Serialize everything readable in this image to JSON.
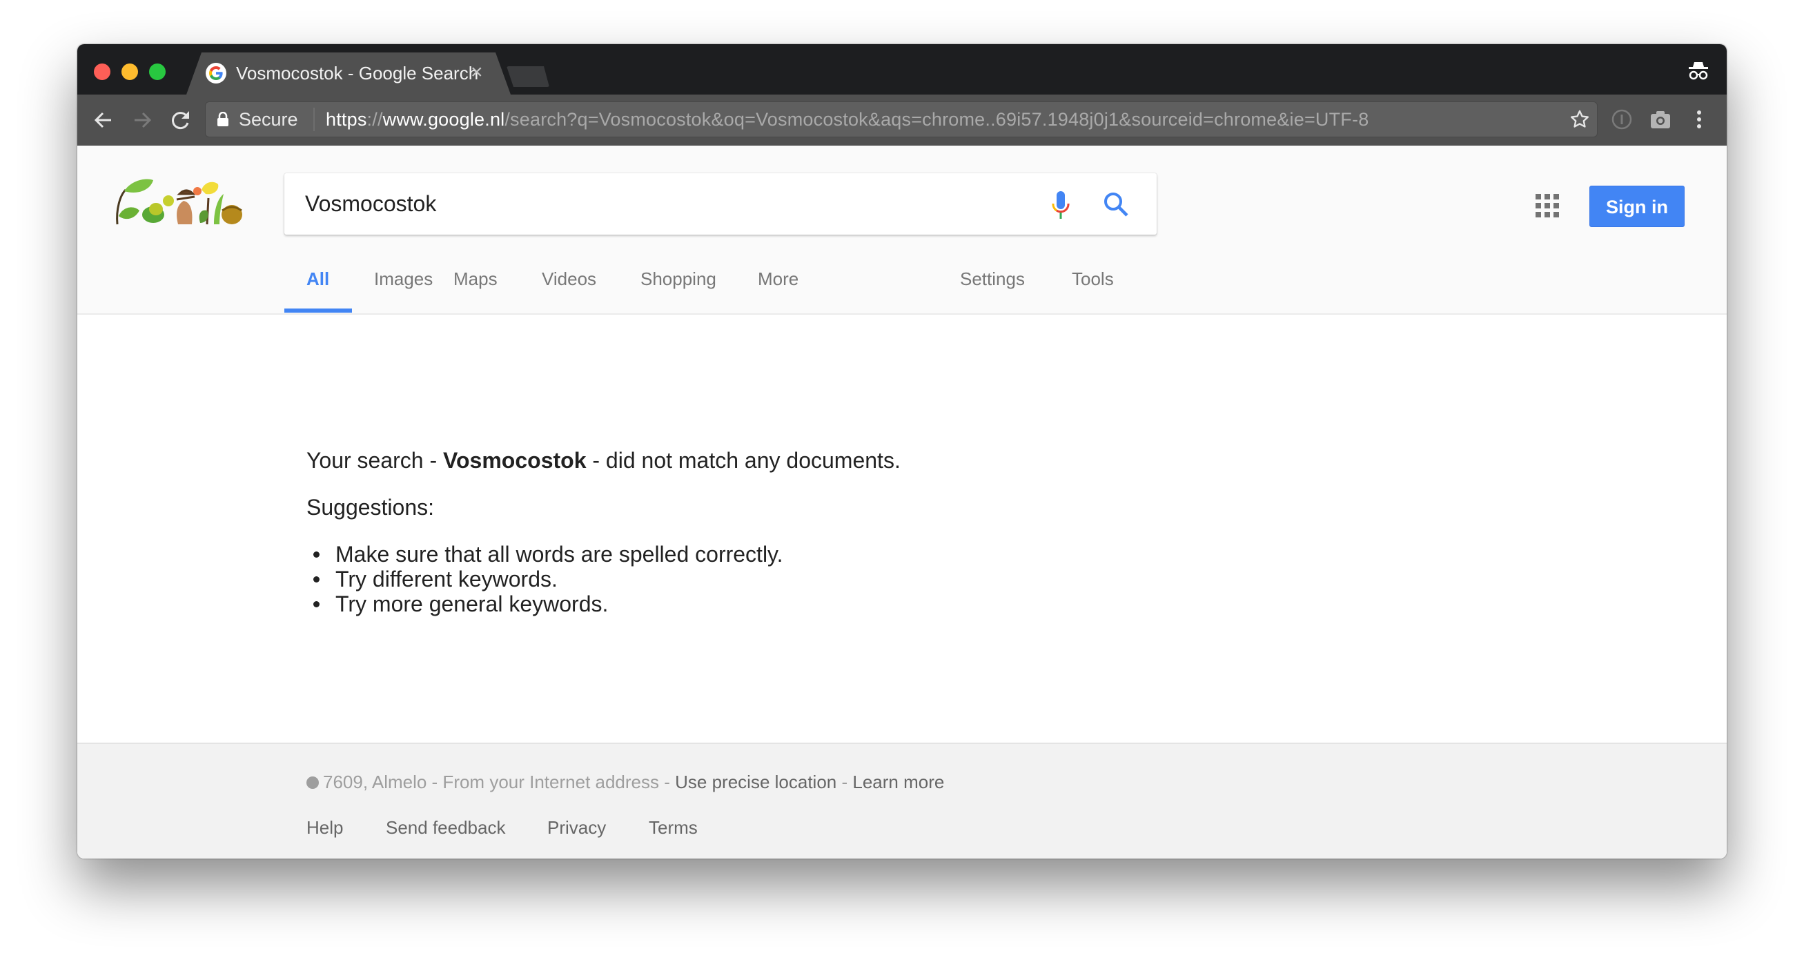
{
  "browser": {
    "tab": {
      "title": "Vosmocostok - Google Search",
      "close_glyph": "×"
    },
    "omnibox": {
      "secure_label": "Secure",
      "url_scheme": "https",
      "url_sep": "://",
      "url_host": "www.google.nl",
      "url_rest": "/search?q=Vosmocostok&oq=Vosmocostok&aqs=chrome..69i57.1948j0j1&sourceid=chrome&ie=UTF-8"
    },
    "icons": [
      "back-icon",
      "forward-icon",
      "reload-icon",
      "lock-icon",
      "star-icon",
      "info-icon",
      "camera-icon",
      "menu-icon",
      "incognito-icon"
    ]
  },
  "header": {
    "logo": "google-doodle",
    "search_value": "Vosmocostok",
    "sign_in_label": "Sign in",
    "tabs": [
      {
        "label": "All",
        "active": true
      },
      {
        "label": "Images"
      },
      {
        "label": "Maps"
      },
      {
        "label": "Videos"
      },
      {
        "label": "Shopping"
      },
      {
        "label": "More"
      }
    ],
    "tools": [
      {
        "label": "Settings"
      },
      {
        "label": "Tools"
      }
    ]
  },
  "result": {
    "prefix": "Your search - ",
    "query": "Vosmocostok",
    "suffix": " - did not match any documents.",
    "suggestions_heading": "Suggestions:",
    "suggestions": [
      "Make sure that all words are spelled correctly.",
      "Try different keywords.",
      "Try more general keywords."
    ]
  },
  "footer": {
    "location": "7609, Almelo",
    "location_source": " - From your Internet address - ",
    "precise_link": "Use precise location",
    "sep": " - ",
    "learn_more": "Learn more",
    "links": [
      "Help",
      "Send feedback",
      "Privacy",
      "Terms"
    ]
  },
  "colors": {
    "accent": "#4285f4",
    "tabstrip": "#1d1e20",
    "toolbar": "#505050"
  }
}
